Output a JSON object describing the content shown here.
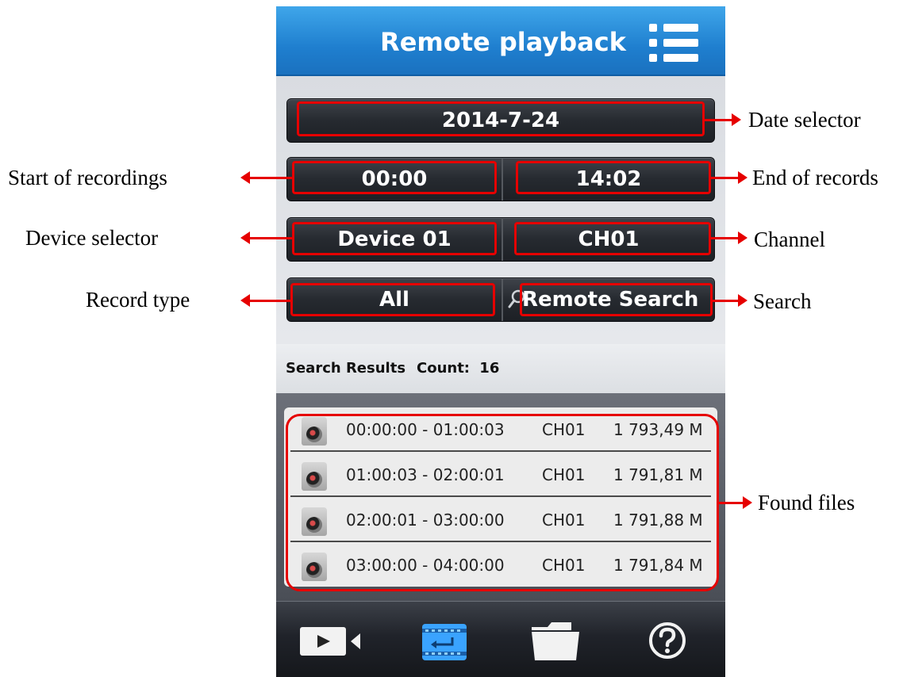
{
  "header": {
    "title": "Remote playback",
    "menu_icon": "list-menu-icon"
  },
  "controls": {
    "date": "2014-7-24",
    "start_time": "00:00",
    "end_time": "14:02",
    "device": "Device 01",
    "channel": "CH01",
    "record_type": "All",
    "search_label": "Remote Search",
    "search_icon": "search-icon"
  },
  "results": {
    "label": "Search Results",
    "count_label": "Count:",
    "count": "16",
    "items": [
      {
        "time": "00:00:00 - 01:00:03",
        "channel": "CH01",
        "size": "1 793,49 M",
        "icon": "camera-icon"
      },
      {
        "time": "01:00:03 - 02:00:01",
        "channel": "CH01",
        "size": "1 791,81 M",
        "icon": "camera-icon"
      },
      {
        "time": "02:00:01 - 03:00:00",
        "channel": "CH01",
        "size": "1 791,88 M",
        "icon": "camera-icon"
      },
      {
        "time": "03:00:00 - 04:00:00",
        "channel": "CH01",
        "size": "1 791,84 M",
        "icon": "camera-icon"
      }
    ]
  },
  "tabs": [
    {
      "icon": "live-video-icon",
      "active": false
    },
    {
      "icon": "playback-icon",
      "active": true
    },
    {
      "icon": "folder-icon",
      "active": false
    },
    {
      "icon": "help-icon",
      "active": false
    }
  ],
  "annotations": {
    "date_selector": "Date selector",
    "start": "Start of recordings",
    "end": "End of records",
    "device": "Device selector",
    "channel": "Channel",
    "record_type": "Record type",
    "search": "Search",
    "found_files": "Found files"
  },
  "colors": {
    "accent_blue": "#1f7fcf",
    "annotation_red": "#e60000",
    "active_tab_blue": "#3aa3ff"
  }
}
